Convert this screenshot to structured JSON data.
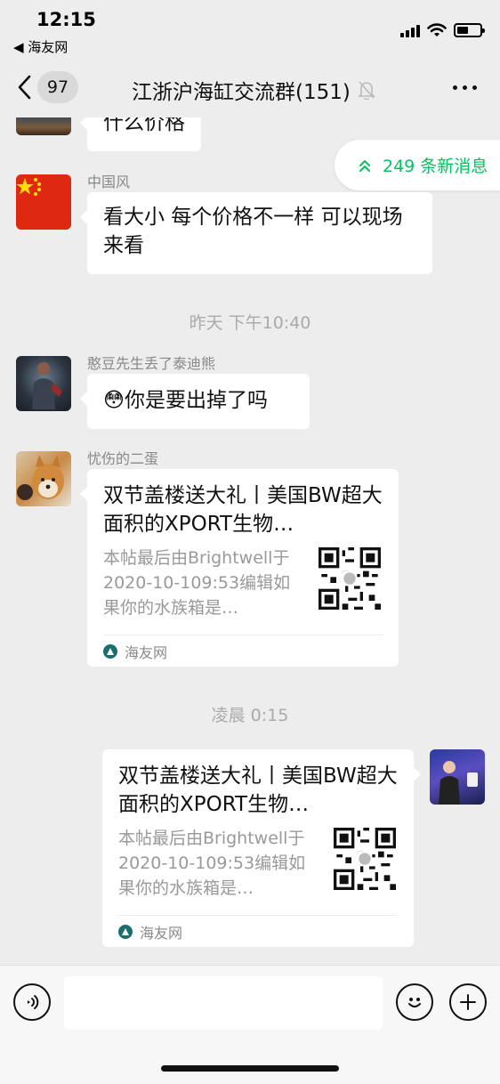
{
  "status_bar": {
    "time": "12:15",
    "back_app": "◀ 海友网",
    "battery_level": 0.5
  },
  "nav": {
    "unread_count": "97",
    "title": "江浙沪海缸交流群(151)",
    "icons": [
      "back-chevron-icon",
      "mute-bell-icon",
      "more-icon"
    ]
  },
  "new_messages": {
    "label": "249 条新消息",
    "color": "#07c160"
  },
  "messages": [
    {
      "type": "text",
      "side": "left",
      "text": "什么价格"
    },
    {
      "type": "text",
      "side": "left",
      "sender": "中国风",
      "text": "看大小 每个价格不一样 可以现场来看"
    },
    {
      "type": "time",
      "text": "昨天 下午10:40"
    },
    {
      "type": "text",
      "side": "left",
      "sender": "憨豆先生丢了泰迪熊",
      "text": "你是要出掉了吗",
      "emoji": "😳"
    },
    {
      "type": "card",
      "side": "left",
      "sender": "忧伤的二蛋",
      "title": "双节盖楼送大礼丨美国BW超大面积的XPORT生物…",
      "desc": "本帖最后由Brightwell于2020-10-109:53编辑如果你的水族箱是…",
      "source": "海友网"
    },
    {
      "type": "time",
      "text": "凌晨 0:15"
    },
    {
      "type": "card",
      "side": "right",
      "title": "双节盖楼送大礼丨美国BW超大面积的XPORT生物…",
      "desc": "本帖最后由Brightwell于2020-10-109:53编辑如果你的水族箱是…",
      "source": "海友网"
    }
  ],
  "input_bar": {
    "placeholder": "",
    "icons": [
      "voice-icon",
      "emoji-icon",
      "plus-icon"
    ]
  }
}
